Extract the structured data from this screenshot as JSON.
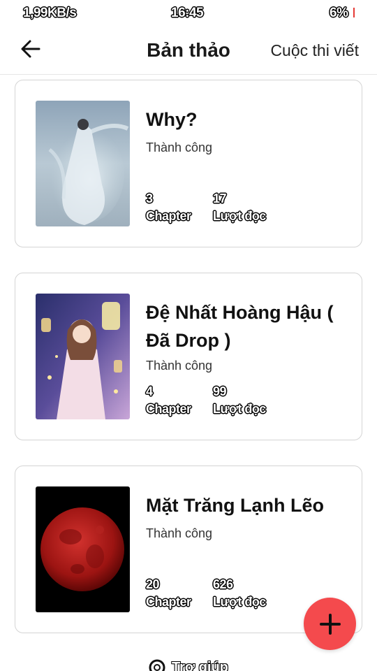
{
  "status_bar": {
    "speed": "1,99KB/s",
    "time": "16:45",
    "battery": "6%",
    "battery_color": "#e53935"
  },
  "header": {
    "back_icon": "arrow-left-icon",
    "title": "Bản thảo",
    "contest_link": "Cuộc thi viết"
  },
  "stories": [
    {
      "title": "Why?",
      "status": "Thành công",
      "chapters": "3",
      "chapter_label": "Chapter",
      "reads": "17",
      "reads_label": "Lượt đọc"
    },
    {
      "title": "Đệ Nhất Hoàng Hậu ( Đã Drop )",
      "status": "Thành công",
      "chapters": "4",
      "chapter_label": "Chapter",
      "reads": "99",
      "reads_label": "Lượt đọc"
    },
    {
      "title": "Mặt Trăng Lạnh Lẽo",
      "status": "Thành công",
      "chapters": "20",
      "chapter_label": "Chapter",
      "reads": "626",
      "reads_label": "Lượt đọc"
    }
  ],
  "fab": {
    "icon": "plus-icon",
    "color": "#f44a4d"
  },
  "help": {
    "icon": "help-icon",
    "label": "Trợ giúp"
  }
}
